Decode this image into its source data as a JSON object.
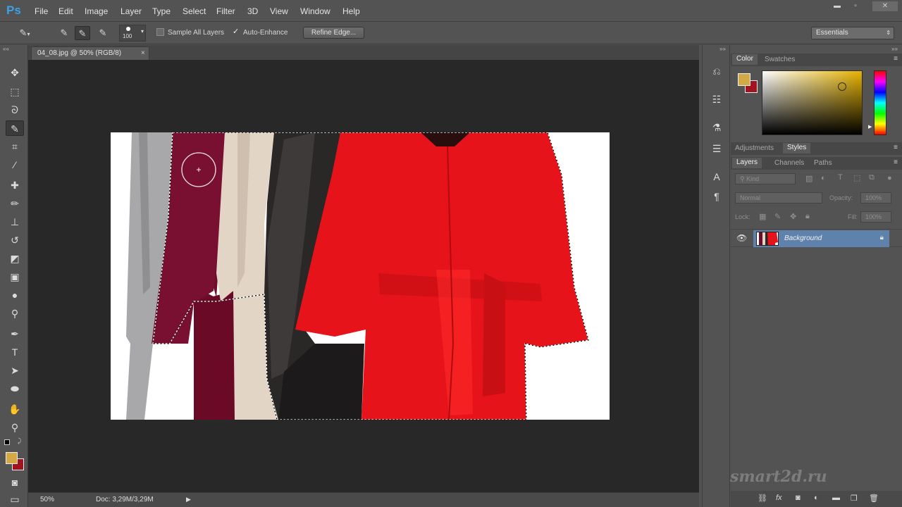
{
  "app": {
    "logo": "Ps"
  },
  "menu": [
    "File",
    "Edit",
    "Image",
    "Layer",
    "Type",
    "Select",
    "Filter",
    "3D",
    "View",
    "Window",
    "Help"
  ],
  "window_controls": {
    "minimize": "▬",
    "restore": "▫",
    "close": "✕"
  },
  "options": {
    "brush_size": "100",
    "sample_all_layers": "Sample All Layers",
    "sample_all_layers_checked": false,
    "auto_enhance": "Auto-Enhance",
    "auto_enhance_checked": true,
    "refine_edge": "Refine Edge...",
    "workspace": "Essentials"
  },
  "document": {
    "tab_title": "04_08.jpg @ 50% (RGB/8)",
    "close": "×",
    "zoom": "50%",
    "doc_size": "Doc: 3,29M/3,29M"
  },
  "color_panel": {
    "tabs": [
      "Color",
      "Swatches"
    ],
    "active_tab": "Color",
    "foreground": "#d3a946",
    "background": "#a3131f"
  },
  "adjustments_tabs": [
    "Adjustments",
    "Styles"
  ],
  "layers_tabs": [
    "Layers",
    "Channels",
    "Paths"
  ],
  "layers_panel": {
    "filter": "Kind",
    "blend_mode": "Normal",
    "opacity_label": "Opacity:",
    "opacity": "100%",
    "lock_label": "Lock:",
    "fill_label": "Fill:",
    "fill": "100%",
    "layers": [
      {
        "name": "Background",
        "visible": true,
        "locked": true
      }
    ]
  },
  "watermark": "smart2d.ru"
}
